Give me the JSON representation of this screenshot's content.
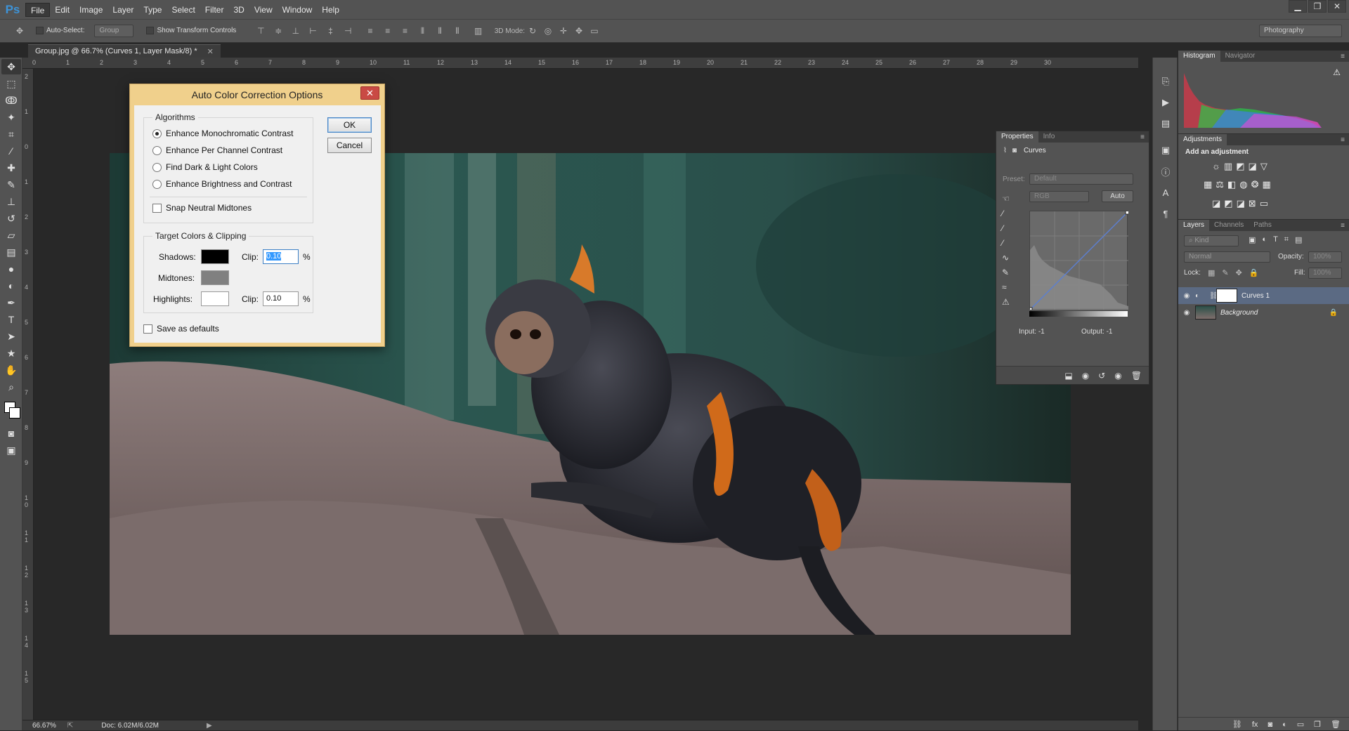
{
  "app": {
    "logo": "Ps"
  },
  "menu": [
    "File",
    "Edit",
    "Image",
    "Layer",
    "Type",
    "Select",
    "Filter",
    "3D",
    "View",
    "Window",
    "Help"
  ],
  "options_bar": {
    "auto_select_label": "Auto-Select:",
    "auto_select_value": "Group",
    "show_transform_label": "Show Transform Controls",
    "mode_3d_label": "3D Mode:",
    "workspace": "Photography"
  },
  "document": {
    "tab_title": "Group.jpg @ 66.7% (Curves 1, Layer Mask/8) *",
    "ruler_h": [
      "0",
      "1",
      "2",
      "3",
      "4",
      "5",
      "6",
      "7",
      "8",
      "9",
      "10",
      "11",
      "12",
      "13",
      "14",
      "15",
      "16",
      "17",
      "18",
      "19",
      "20",
      "21",
      "22",
      "23",
      "24",
      "25",
      "26",
      "27",
      "28",
      "29",
      "30"
    ],
    "ruler_v": [
      "2",
      "1",
      "0",
      "1",
      "2",
      "3",
      "4",
      "5",
      "6",
      "7",
      "8",
      "9",
      "1 0",
      "1 1",
      "1 2",
      "1 3",
      "1 4",
      "1 5"
    ],
    "zoom": "66.67%",
    "doc_size": "Doc: 6.02M/6.02M"
  },
  "dialog": {
    "title": "Auto Color Correction Options",
    "close": "✕",
    "algorithms_title": "Algorithms",
    "algorithms": [
      {
        "label": "Enhance Monochromatic Contrast",
        "selected": true
      },
      {
        "label": "Enhance Per Channel Contrast",
        "selected": false
      },
      {
        "label": "Find Dark & Light Colors",
        "selected": false
      },
      {
        "label": "Enhance Brightness and Contrast",
        "selected": false
      }
    ],
    "snap_label": "Snap Neutral Midtones",
    "target_title": "Target Colors & Clipping",
    "shadows_label": "Shadows:",
    "midtones_label": "Midtones:",
    "highlights_label": "Highlights:",
    "clip_label": "Clip:",
    "shadows_clip": "0.10",
    "highlights_clip": "0.10",
    "percent": "%",
    "save_defaults_label": "Save as defaults",
    "ok": "OK",
    "cancel": "Cancel",
    "colors": {
      "shadows": "#000000",
      "midtones": "#808080",
      "highlights": "#ffffff"
    }
  },
  "properties": {
    "tabs": [
      "Properties",
      "Info"
    ],
    "title": "Curves",
    "preset_label": "Preset:",
    "preset_value": "Default",
    "channel": "RGB",
    "auto": "Auto",
    "input_label": "Input:",
    "input_value": "-1",
    "output_label": "Output:",
    "output_value": "-1"
  },
  "histogram_panel": {
    "tabs": [
      "Histogram",
      "Navigator"
    ]
  },
  "adjustments_panel": {
    "tab": "Adjustments",
    "subtitle": "Add an adjustment"
  },
  "layers_panel": {
    "tabs": [
      "Layers",
      "Channels",
      "Paths"
    ],
    "kind": "Kind",
    "blend_mode": "Normal",
    "opacity_label": "Opacity:",
    "opacity_value": "100%",
    "lock_label": "Lock:",
    "fill_label": "Fill:",
    "fill_value": "100%",
    "layers": [
      {
        "name": "Curves 1",
        "selected": true
      },
      {
        "name": "Background",
        "selected": false
      }
    ]
  }
}
